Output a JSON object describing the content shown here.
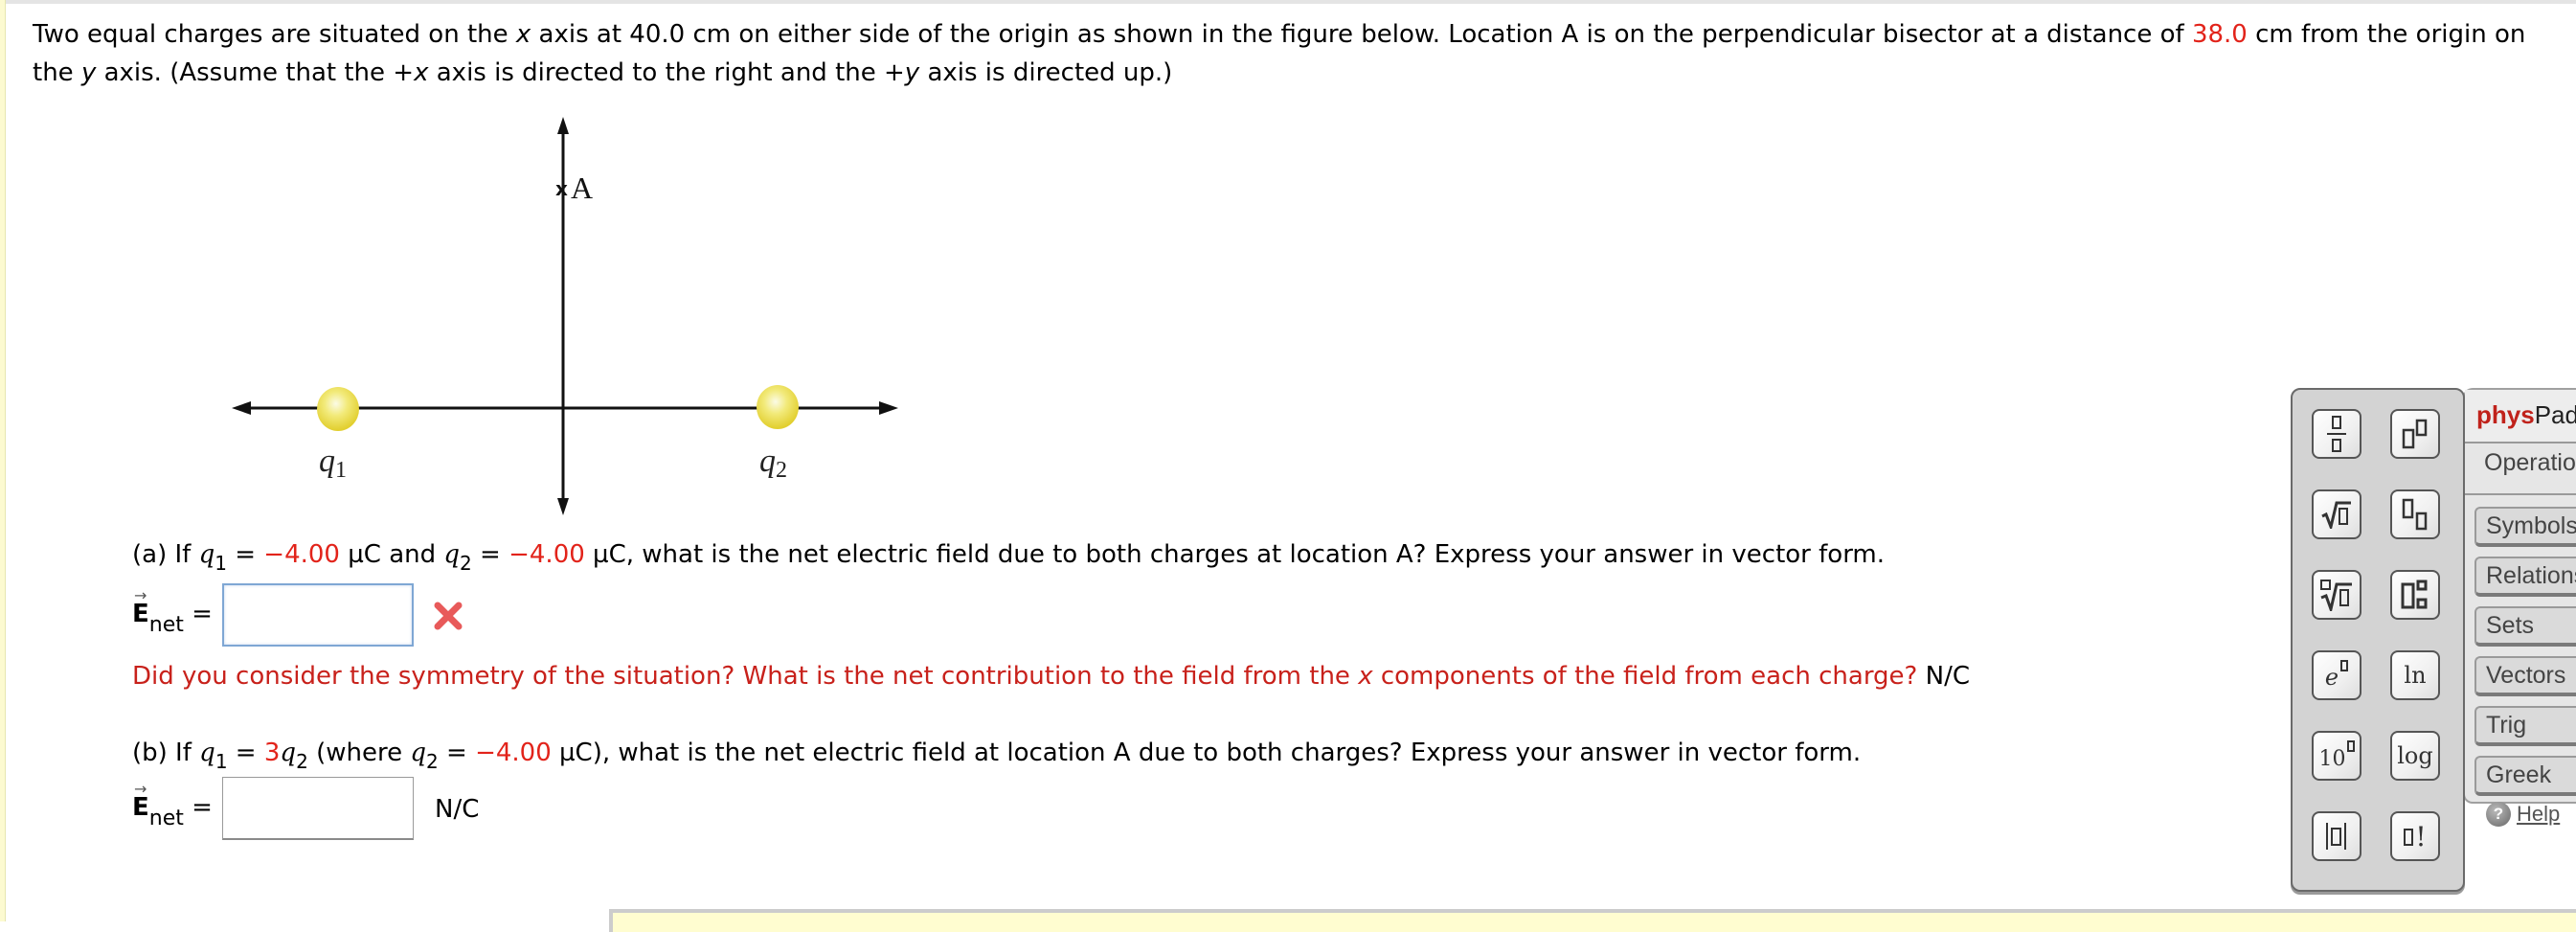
{
  "intro": {
    "part1": "Two equal charges are situated on the ",
    "x": "x",
    "part2": " axis at 40.0 cm on either side of the origin as shown in the figure below. Location A is on the perpendicular bisector at a distance of ",
    "distance": "38.0",
    "part3": " cm from the origin on the ",
    "y": "y",
    "part4": " axis. (Assume that the +",
    "x2": "x",
    "part5": " axis is directed to the right and the +",
    "y2": "y",
    "part6": " axis is directed up.)"
  },
  "figure": {
    "point_label": "A",
    "point_marker": "x",
    "q1_label": "q",
    "q1_sub": "1",
    "q2_label": "q",
    "q2_sub": "2",
    "charge_color": "#e8d83a"
  },
  "part_a": {
    "prefix": "(a) If ",
    "q1": "q",
    "q1_sub": "1",
    "eq1": " = ",
    "q1_value": "−4.00",
    "mid": " µC and ",
    "q2": "q",
    "q2_sub": "2",
    "eq2": " = ",
    "q2_value": "−4.00",
    "suffix": " µC, what is the net electric field due to both charges at location A? Express your answer in vector form.",
    "answer_label_E": "E",
    "answer_label_sub": "net",
    "answer_eq": " =",
    "answer_value": "",
    "status": "incorrect",
    "hint_part1": "Did you consider the symmetry of the situation? What is the net contribution to the field from the ",
    "hint_x": "x",
    "hint_part2": " components of the field from each charge?",
    "unit": " N/C"
  },
  "part_b": {
    "prefix": "(b) If ",
    "q1": "q",
    "q1_sub": "1",
    "eq1": " = ",
    "factor": "3",
    "q2a": "q",
    "q2a_sub": "2",
    "mid": " (where ",
    "q2": "q",
    "q2_sub": "2",
    "eq2": " = ",
    "q2_value": "−4.00",
    "suffix": " µC), what is the net electric field at location A due to both charges? Express your answer in vector form.",
    "answer_label_E": "E",
    "answer_label_sub": "net",
    "answer_eq": " =",
    "answer_value": "",
    "unit": "N/C"
  },
  "physpad": {
    "brand_bold": "phys",
    "brand_rest": "Pad",
    "operations_label": "Operations",
    "tabs": [
      "Symbols",
      "Relations",
      "Sets",
      "Vectors",
      "Trig",
      "Greek"
    ],
    "help_label": "Help",
    "buttons": [
      "fraction",
      "superscript",
      "square-root",
      "subscript",
      "nth-root",
      "sub-superscript",
      "exp",
      "ln",
      "ten-power",
      "log",
      "absolute-value",
      "factorial"
    ],
    "ln_label": "ln",
    "log_label": "log",
    "ten_label": "10",
    "e_label": "e",
    "fact_label": "!"
  }
}
